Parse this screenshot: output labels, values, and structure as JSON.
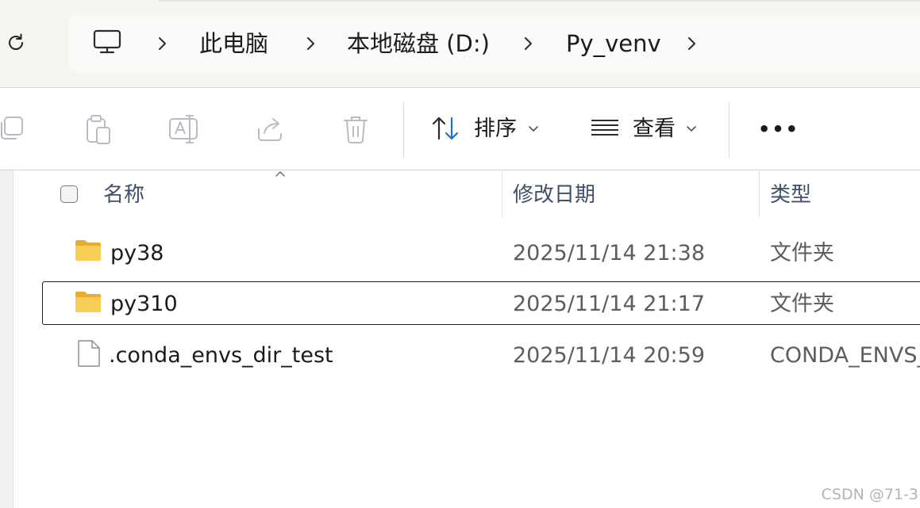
{
  "address_bar": {
    "breadcrumbs": [
      "此电脑",
      "本地磁盘 (D:)",
      "Py_venv"
    ],
    "icons": {
      "refresh": "refresh-icon",
      "computer": "computer-monitor-icon",
      "separator": "chevron-right-icon"
    }
  },
  "command_bar": {
    "icons": [
      "copy-icon",
      "paste-icon",
      "rename-icon",
      "share-icon",
      "delete-icon"
    ],
    "sort_label": "排序",
    "view_label": "查看",
    "more_label": "•••"
  },
  "columns": {
    "name": "名称",
    "date": "修改日期",
    "type": "类型"
  },
  "files": [
    {
      "name": "py38",
      "modified": "2025/11/14 21:38",
      "type": "文件夹",
      "icon": "folder-icon"
    },
    {
      "name": "py310",
      "modified": "2025/11/14 21:17",
      "type": "文件夹",
      "icon": "folder-icon"
    },
    {
      "name": ".conda_envs_dir_test",
      "modified": "2025/11/14 20:59",
      "type": "CONDA_ENVS_",
      "icon": "file-icon"
    }
  ],
  "watermark": "CSDN @71-3",
  "colors": {
    "address_background": "#f3f5ef",
    "folder_yellow": "#f5c84c",
    "sort_accent": "#1a73c9",
    "header_text": "#40506a"
  }
}
